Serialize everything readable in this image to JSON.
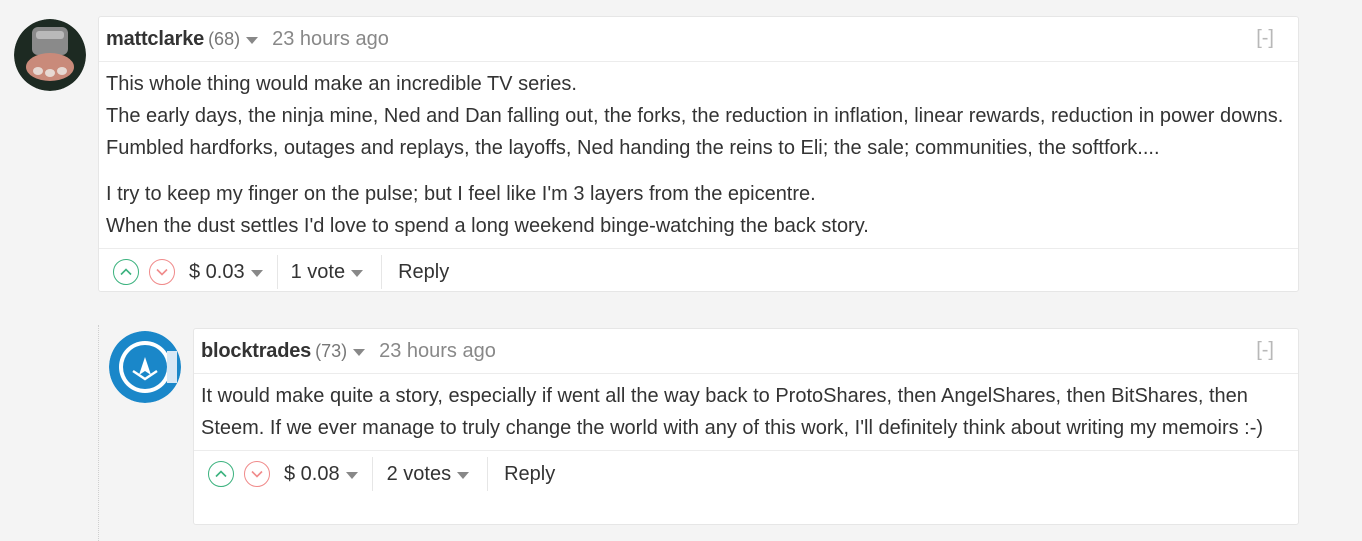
{
  "comments": [
    {
      "author": "mattclarke",
      "reputation": "(68)",
      "time": "23 hours ago",
      "collapse": "[-]",
      "paragraphs": [
        "This whole thing would make an incredible TV series.",
        "The early days, the ninja mine, Ned and Dan falling out, the forks, the reduction in inflation, linear rewards, reduction in power downs. Fumbled hardforks, outages and replays, the layoffs, Ned handing the reins to Eli; the sale; communities, the softfork....",
        "I try to keep my finger on the pulse; but I feel like I'm 3 layers from the epicentre.",
        "When the dust settles I'd love to spend a long weekend binge-watching the back story."
      ],
      "payout": "$ 0.03",
      "votes": "1 vote",
      "reply": "Reply"
    },
    {
      "author": "blocktrades",
      "reputation": "(73)",
      "time": "23 hours ago",
      "collapse": "[-]",
      "paragraphs": [
        "It would make quite a story, especially if went all the way back to ProtoShares, then AngelShares, then BitShares, then Steem. If we ever manage to truly change the world with any of this work, I'll definitely think about writing my memoirs :-)"
      ],
      "payout": "$ 0.08",
      "votes": "2 votes",
      "reply": "Reply"
    }
  ],
  "icons": {
    "upvote": "chevron-up-circle-icon",
    "downvote": "chevron-down-circle-icon",
    "dropdown": "caret-down-icon"
  },
  "colors": {
    "upvote": "#3bb27e",
    "downvote": "#f08a8a",
    "text": "#333333",
    "muted": "#888888",
    "background": "#f4f4f4"
  }
}
